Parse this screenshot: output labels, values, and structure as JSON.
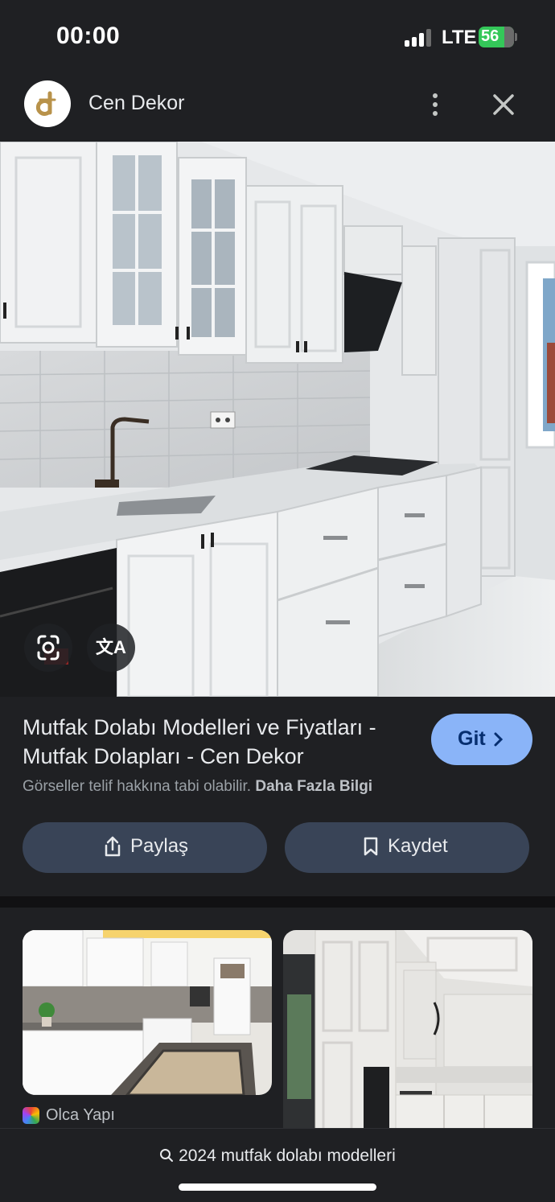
{
  "status_bar": {
    "time": "00:00",
    "network": "LTE",
    "battery": "56"
  },
  "header": {
    "site_name": "Cen Dekor",
    "logo_icon": "cen-dekor-logo",
    "more_icon": "more-vert-icon",
    "close_icon": "close-icon"
  },
  "image_actions": {
    "lens_icon": "google-lens-icon",
    "translate_label": "文A"
  },
  "info": {
    "title": "Mutfak Dolabı Modelleri ve Fiyatları - Mutfak Dolapları - Cen Dekor",
    "visit_label": "Git",
    "copyright_text": "Görseller telif hakkına tabi olabilir.",
    "learn_more": "Daha Fazla Bilgi",
    "share_label": "Paylaş",
    "save_label": "Kaydet"
  },
  "related": {
    "source_name": "Olca Yapı"
  },
  "bottom": {
    "search_query": "2024 mutfak dolabı modelleri"
  },
  "colors": {
    "background": "#1f2023",
    "accent": "#8ab4f8",
    "button": "#394457"
  }
}
